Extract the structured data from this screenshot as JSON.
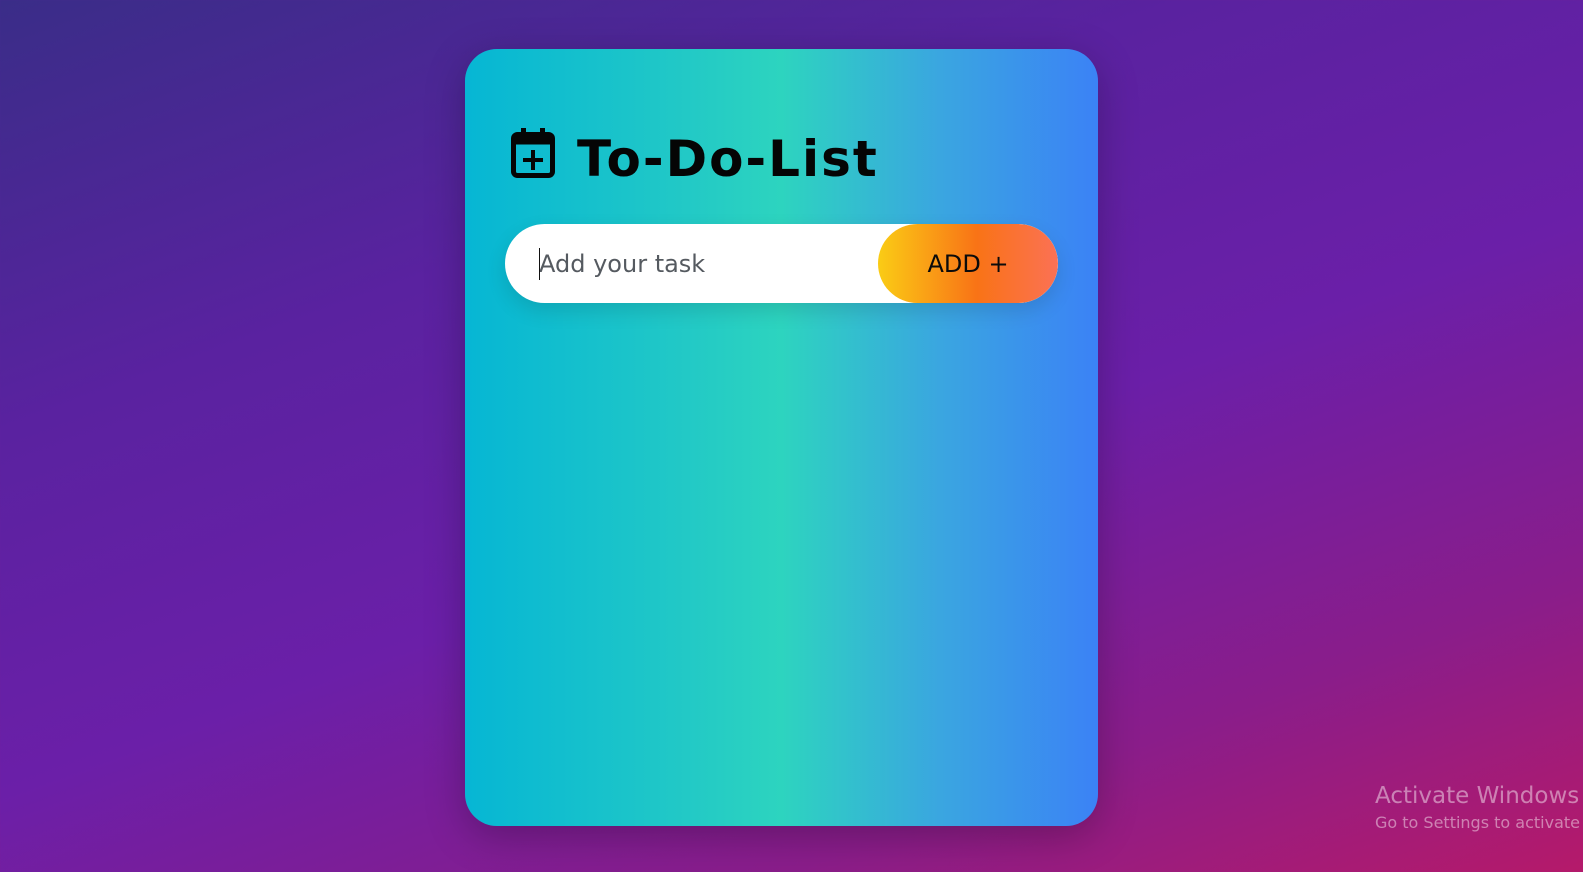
{
  "app": {
    "title": "To-Do-List",
    "title_icon": "calendar-plus-icon"
  },
  "task_form": {
    "input_placeholder": "Add your task",
    "input_value": "",
    "add_button_label": "ADD +"
  },
  "tasks": [],
  "colors": {
    "card_gradient": [
      "#06b6d4",
      "#2dd4bf",
      "#3b82f6"
    ],
    "button_gradient": [
      "#facc15",
      "#f97316",
      "#fb7155"
    ],
    "background_gradient": [
      "#3a2d88",
      "#6b1fa8",
      "#b51a6a"
    ]
  },
  "os_watermark": {
    "title": "Activate Windows",
    "subtitle": "Go to Settings to activate Windows."
  }
}
